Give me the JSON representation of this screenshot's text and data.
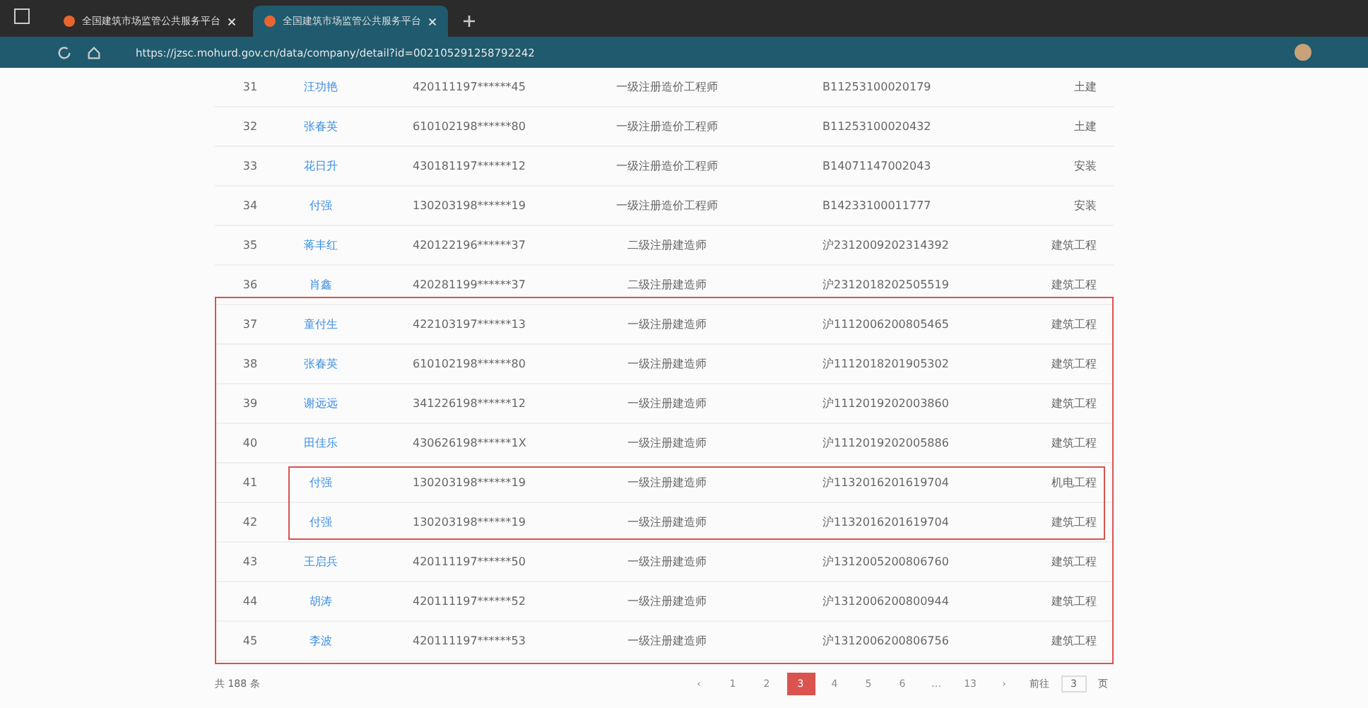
{
  "browser": {
    "tabs": [
      {
        "title": "全国建筑市场监管公共服务平台",
        "selected": false
      },
      {
        "title": "全国建筑市场监管公共服务平台",
        "selected": true
      }
    ],
    "url": "https://jzsc.mohurd.gov.cn/data/company/detail?id=002105291258792242"
  },
  "table": {
    "rows": [
      {
        "index": "31",
        "name": "汪功艳",
        "id_number": "420111197******45",
        "certificate": "一级注册造价工程师",
        "reg_number": "B11253100020179",
        "profession": "土建"
      },
      {
        "index": "32",
        "name": "张春英",
        "id_number": "610102198******80",
        "certificate": "一级注册造价工程师",
        "reg_number": "B11253100020432",
        "profession": "土建"
      },
      {
        "index": "33",
        "name": "花日升",
        "id_number": "430181197******12",
        "certificate": "一级注册造价工程师",
        "reg_number": "B14071147002043",
        "profession": "安装"
      },
      {
        "index": "34",
        "name": "付强",
        "id_number": "130203198******19",
        "certificate": "一级注册造价工程师",
        "reg_number": "B14233100011777",
        "profession": "安装"
      },
      {
        "index": "35",
        "name": "蒋丰红",
        "id_number": "420122196******37",
        "certificate": "二级注册建造师",
        "reg_number": "沪2312009202314392",
        "profession": "建筑工程"
      },
      {
        "index": "36",
        "name": "肖鑫",
        "id_number": "420281199******37",
        "certificate": "二级注册建造师",
        "reg_number": "沪2312018202505519",
        "profession": "建筑工程"
      },
      {
        "index": "37",
        "name": "童付生",
        "id_number": "422103197******13",
        "certificate": "一级注册建造师",
        "reg_number": "沪1112006200805465",
        "profession": "建筑工程"
      },
      {
        "index": "38",
        "name": "张春英",
        "id_number": "610102198******80",
        "certificate": "一级注册建造师",
        "reg_number": "沪1112018201905302",
        "profession": "建筑工程"
      },
      {
        "index": "39",
        "name": "谢远远",
        "id_number": "341226198******12",
        "certificate": "一级注册建造师",
        "reg_number": "沪1112019202003860",
        "profession": "建筑工程"
      },
      {
        "index": "40",
        "name": "田佳乐",
        "id_number": "430626198******1X",
        "certificate": "一级注册建造师",
        "reg_number": "沪1112019202005886",
        "profession": "建筑工程"
      },
      {
        "index": "41",
        "name": "付强",
        "id_number": "130203198******19",
        "certificate": "一级注册建造师",
        "reg_number": "沪1132016201619704",
        "profession": "机电工程"
      },
      {
        "index": "42",
        "name": "付强",
        "id_number": "130203198******19",
        "certificate": "一级注册建造师",
        "reg_number": "沪1132016201619704",
        "profession": "建筑工程"
      },
      {
        "index": "43",
        "name": "王启兵",
        "id_number": "420111197******50",
        "certificate": "一级注册建造师",
        "reg_number": "沪1312005200806760",
        "profession": "建筑工程"
      },
      {
        "index": "44",
        "name": "胡涛",
        "id_number": "420111197******52",
        "certificate": "一级注册建造师",
        "reg_number": "沪1312006200800944",
        "profession": "建筑工程"
      },
      {
        "index": "45",
        "name": "李波",
        "id_number": "420111197******53",
        "certificate": "一级注册建造师",
        "reg_number": "沪1312006200806756",
        "profession": "建筑工程"
      }
    ]
  },
  "pagination": {
    "total": "共 188 条",
    "prev": "‹",
    "pages": [
      {
        "label": "1",
        "selected": false
      },
      {
        "label": "2",
        "selected": false
      },
      {
        "label": "3",
        "selected": true
      },
      {
        "label": "4",
        "selected": false
      },
      {
        "label": "5",
        "selected": false
      },
      {
        "label": "6",
        "selected": false
      },
      {
        "label": "…",
        "selected": false
      },
      {
        "label": "13",
        "selected": false
      }
    ],
    "next": "›",
    "goto_label": "前往",
    "goto_value": "3",
    "goto_unit": "页"
  }
}
